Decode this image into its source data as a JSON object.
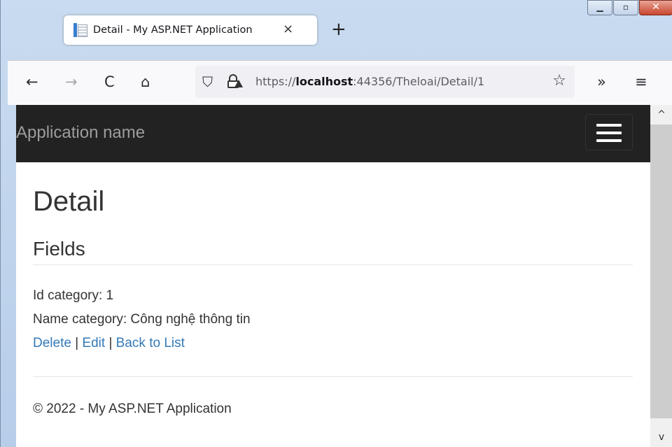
{
  "tab": {
    "title": "Detail - My ASP.NET Application",
    "close_glyph": "×"
  },
  "new_tab_glyph": "+",
  "window_controls": {
    "minimize": "▁",
    "maximize": "▫",
    "close": "✕"
  },
  "toolbar": {
    "back": "←",
    "forward": "→",
    "reload": "C",
    "home": "⌂",
    "overflow": "»",
    "menu": "≡"
  },
  "url": {
    "scheme": "https://",
    "host": "localhost",
    "rest": ":44356/Theloai/Detail/1"
  },
  "url_icons": {
    "shield": "⛉",
    "star": "☆"
  },
  "page": {
    "brand": "Application name",
    "title": "Detail",
    "section": "Fields",
    "id_line": "Id category: 1",
    "name_line": "Name category: Công nghệ thông tin",
    "actions": {
      "delete": "Delete",
      "edit": "Edit",
      "back": "Back to List",
      "sep": " | "
    },
    "footer": "© 2022 - My ASP.NET Application"
  },
  "scrollbar": {
    "up": "^",
    "down": "v"
  },
  "colors": {
    "navbar": "#222222",
    "link": "#337ab7",
    "brand_text": "#9d9d9d"
  }
}
